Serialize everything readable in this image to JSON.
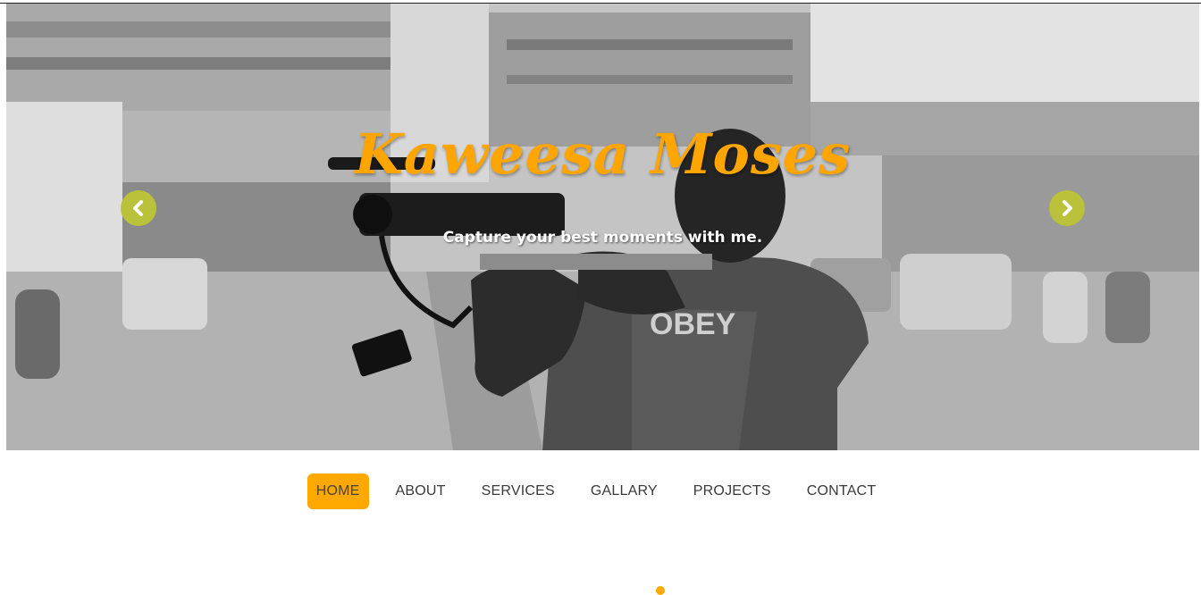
{
  "hero": {
    "title": "Kaweesa Moses",
    "tagline": "Capture your best moments with me.",
    "prev_icon": "chevron-left-icon",
    "next_icon": "chevron-right-icon",
    "shirt_text": "OBEY"
  },
  "nav": {
    "items": [
      {
        "label": "HOME",
        "active": true
      },
      {
        "label": "ABOUT",
        "active": false
      },
      {
        "label": "SERVICES",
        "active": false
      },
      {
        "label": "GALLARY",
        "active": false
      },
      {
        "label": "PROJECTS",
        "active": false
      },
      {
        "label": "CONTACT",
        "active": false
      }
    ]
  },
  "colors": {
    "accent": "#ffa800",
    "arrow": "#b9c23a",
    "title": "#ffa500"
  }
}
